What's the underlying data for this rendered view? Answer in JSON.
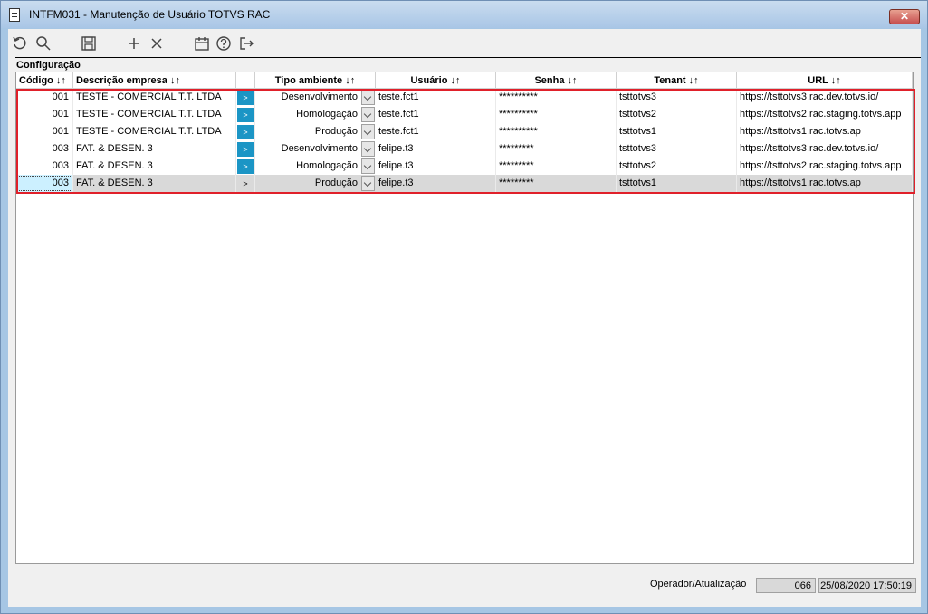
{
  "window": {
    "title": "INTFM031 - Manutenção de Usuário TOTVS RAC",
    "close_label": "✕"
  },
  "toolbar": {
    "icons": [
      "refresh-icon",
      "search-icon",
      "save-icon",
      "add-icon",
      "delete-icon",
      "calendar-icon",
      "help-icon",
      "exit-icon"
    ]
  },
  "section": {
    "title": "Configuração"
  },
  "table": {
    "headers": {
      "codigo": "Código ↓↑",
      "descricao": "Descrição empresa ↓↑",
      "tipo": "Tipo ambiente ↓↑",
      "usuario": "Usuário ↓↑",
      "senha": "Senha ↓↑",
      "tenant": "Tenant ↓↑",
      "url": "URL ↓↑"
    },
    "rows": [
      {
        "codigo": "001",
        "descricao": "TESTE - COMERCIAL T.T. LTDA",
        "btn": ">",
        "tipo": "Desenvolvimento",
        "usuario": "teste.fct1",
        "senha": "**********",
        "tenant": "tsttotvs3",
        "url": "https://tsttotvs3.rac.dev.totvs.io/"
      },
      {
        "codigo": "001",
        "descricao": "TESTE - COMERCIAL T.T. LTDA",
        "btn": ">",
        "tipo": "Homologação",
        "usuario": "teste.fct1",
        "senha": "**********",
        "tenant": "tsttotvs2",
        "url": "https://tsttotvs2.rac.staging.totvs.app"
      },
      {
        "codigo": "001",
        "descricao": "TESTE - COMERCIAL T.T. LTDA",
        "btn": ">",
        "tipo": "Produção",
        "usuario": "teste.fct1",
        "senha": "**********",
        "tenant": "tsttotvs1",
        "url": "https://tsttotvs1.rac.totvs.ap"
      },
      {
        "codigo": "003",
        "descricao": "FAT. & DESEN. 3",
        "btn": ">",
        "tipo": "Desenvolvimento",
        "usuario": "felipe.t3",
        "senha": "*********",
        "tenant": "tsttotvs3",
        "url": "https://tsttotvs3.rac.dev.totvs.io/"
      },
      {
        "codigo": "003",
        "descricao": "FAT. & DESEN. 3",
        "btn": ">",
        "tipo": "Homologação",
        "usuario": "felipe.t3",
        "senha": "*********",
        "tenant": "tsttotvs2",
        "url": "https://tsttotvs2.rac.staging.totvs.app"
      },
      {
        "codigo": "003",
        "descricao": "FAT. & DESEN. 3",
        "btn": ">",
        "tipo": "Produção",
        "usuario": "felipe.t3",
        "senha": "*********",
        "tenant": "tsttotvs1",
        "url": "https://tsttotvs1.rac.totvs.ap"
      }
    ]
  },
  "status": {
    "label": "Operador/Atualização",
    "operator": "066",
    "datetime": "25/08/2020 17:50:19"
  },
  "colors": {
    "accent": "#1b95c5",
    "highlight": "#e0202a",
    "selected_cell": "#ccf0ff"
  }
}
